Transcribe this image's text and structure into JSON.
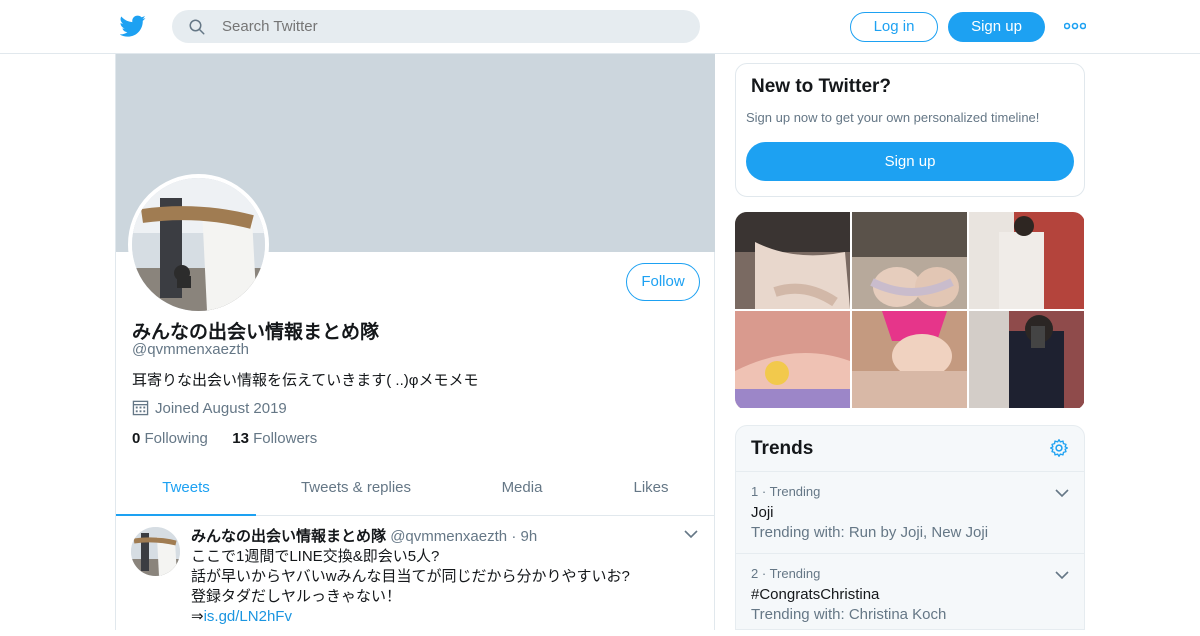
{
  "header": {
    "search_placeholder": "Search Twitter",
    "login_label": "Log in",
    "signup_label": "Sign up",
    "brand_color": "#1da1f2"
  },
  "profile": {
    "name": "みんなの出会い情報まとめ隊",
    "handle": "@qvmmenxaezth",
    "bio": "耳寄りな出会い情報を伝えていきます( ..)φメモメモ",
    "joined": "Joined August 2019",
    "following_count": "0",
    "following_label": "Following",
    "followers_count": "13",
    "followers_label": "Followers",
    "follow_label": "Follow",
    "banner_color": "#ccd6dd"
  },
  "tabs": [
    {
      "label": "Tweets",
      "active": true
    },
    {
      "label": "Tweets & replies",
      "active": false
    },
    {
      "label": "Media",
      "active": false
    },
    {
      "label": "Likes",
      "active": false
    }
  ],
  "tweet": {
    "name": "みんなの出会い情報まとめ隊",
    "handle": "@qvmmenxaezth",
    "separator": "·",
    "time": "9h",
    "line1": "ここで1週間でLINE交換&即会い5人?",
    "line2": "話が早いからヤバいwみんな目当てが同じだから分かりやすいお?",
    "line3": "登録タダだしヤルっきゃない！",
    "link_prefix": "⇒",
    "link": "is.gd/LN2hFv"
  },
  "new_to_twitter": {
    "title": "New to Twitter?",
    "subtitle": "Sign up now to get your own personalized timeline!",
    "button": "Sign up"
  },
  "trends": {
    "title": "Trends",
    "items": [
      {
        "rank": "1",
        "label": "Trending",
        "name": "Joji",
        "with": "Trending with: Run by Joji, New Joji"
      },
      {
        "rank": "2",
        "label": "Trending",
        "name": "#CongratsChristina",
        "with": "Trending with: Christina Koch"
      }
    ]
  },
  "icons": {
    "logo": "twitter-bird-icon",
    "search": "search-icon",
    "more": "more-dots-icon",
    "calendar": "calendar-icon",
    "chevron": "chevron-down-icon",
    "settings": "gear-icon"
  }
}
